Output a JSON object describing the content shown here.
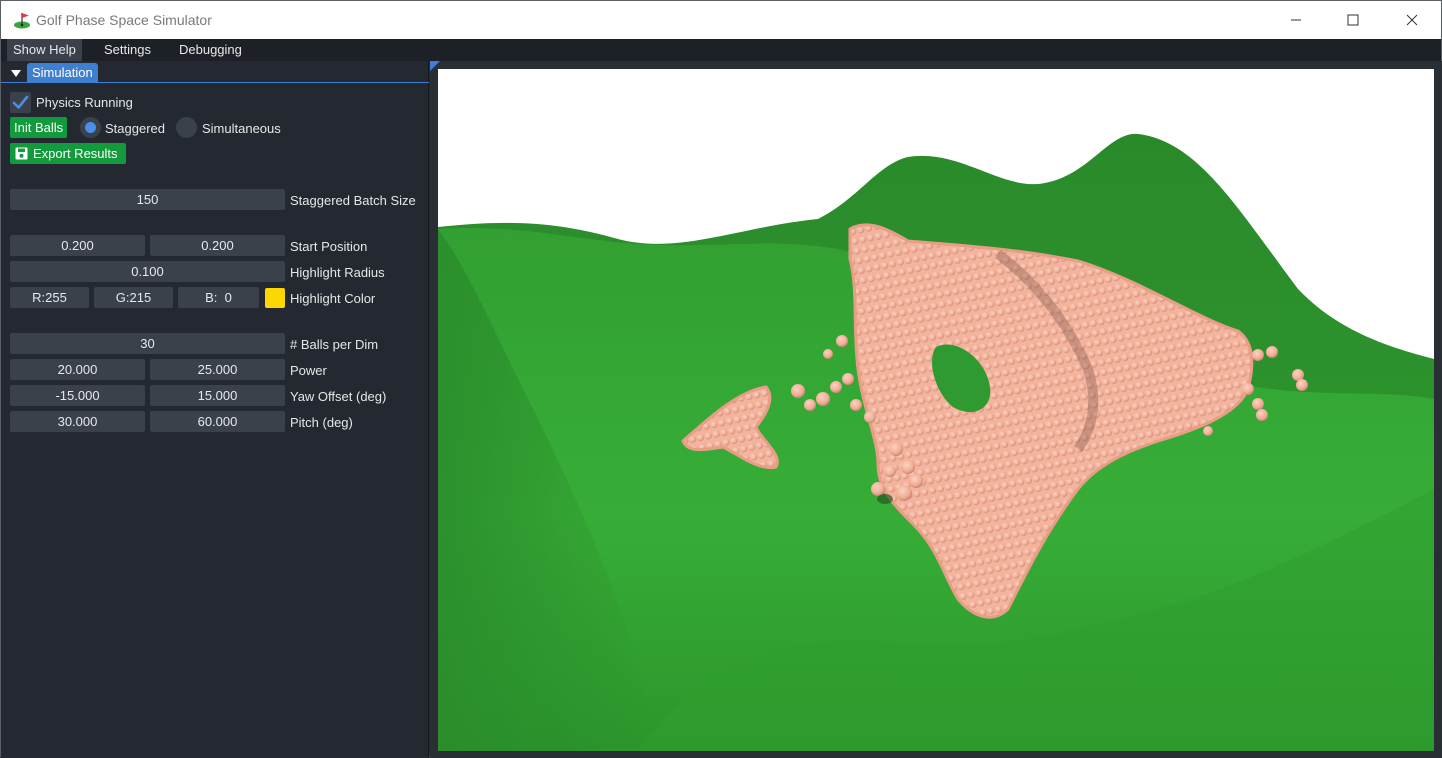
{
  "window": {
    "title": "Golf Phase Space Simulator",
    "controls": [
      "minimize",
      "maximize",
      "close"
    ]
  },
  "menu": {
    "help": "Show Help",
    "settings": "Settings",
    "debugging": "Debugging"
  },
  "panel": {
    "tab": "Simulation",
    "physics_running": {
      "label": "Physics Running",
      "checked": true
    },
    "init_balls": "Init Balls",
    "mode": {
      "options": [
        "Staggered",
        "Simultaneous"
      ],
      "selected": "Staggered"
    },
    "export": "Export Results",
    "batch_size": {
      "value": "150",
      "label": "Staggered Batch Size"
    },
    "start_position": {
      "x": "0.200",
      "y": "0.200",
      "label": "Start Position"
    },
    "highlight_radius": {
      "value": "0.100",
      "label": "Highlight Radius"
    },
    "highlight_color": {
      "r": "R:255",
      "g": "G:215",
      "b": "B:  0",
      "label": "Highlight Color",
      "swatch": "#ffd700"
    },
    "balls_per_dim": {
      "value": "30",
      "label": "# Balls per Dim"
    },
    "power": {
      "min": "20.000",
      "max": "25.000",
      "label": "Power"
    },
    "yaw": {
      "min": "-15.000",
      "max": "15.000",
      "label": "Yaw Offset (deg)"
    },
    "pitch": {
      "min": "30.000",
      "max": "60.000",
      "label": "Pitch (deg)"
    }
  },
  "colors": {
    "accent": "#3f7fcf",
    "green_button": "#139a3c",
    "terrain": "#2f9a2f",
    "balls": "#f3b5a0"
  }
}
